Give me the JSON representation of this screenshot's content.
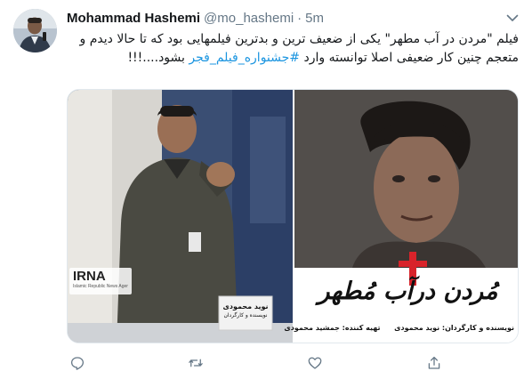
{
  "tweet": {
    "author_name": "Mohammad Hashemi",
    "author_handle": "@mo_hashemi",
    "separator": "·",
    "time": "5m",
    "text_part1": "فیلم \"مردن در آب مطهر\" یکی از ضعیف ترین و بدترین فیلمهایی بود که تا حالا دیدم و متعجم چنین کار ضعیفی اصلا توانسته وارد ",
    "hashtag": "#جشنواره_فیلم_فجر",
    "text_part2": " بشود....!!!"
  },
  "media": {
    "left_photo": {
      "watermark": "IRNA",
      "watermark_sub": "Islamic Republic News Agency",
      "nameplate_name": "نوید محمودی",
      "nameplate_role": "نویسنده و کارگردان"
    },
    "right_photo": {
      "poster_title": "مُردن درآب مُطهر",
      "poster_credits_1": "نویسنده و کارگردان: نوید محمودی",
      "poster_credits_2": "تهیه کننده: جمشید محمودی"
    }
  },
  "icons": {
    "caret": "chevron-down-icon",
    "reply": "reply-icon",
    "retweet": "retweet-icon",
    "like": "like-icon",
    "share": "share-icon"
  },
  "colors": {
    "text_primary": "#14171a",
    "text_secondary": "#657786",
    "link": "#1b95e0",
    "border": "#e1e8ed"
  }
}
